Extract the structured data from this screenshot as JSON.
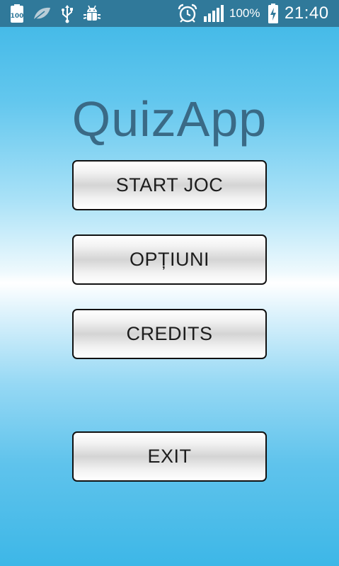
{
  "status_bar": {
    "background": "#30799a",
    "icons_left": [
      "battery-100-icon",
      "leaf-icon",
      "usb-icon",
      "android-debug-icon"
    ],
    "icons_right": [
      "alarm-clock-icon",
      "signal-bars-icon",
      "battery-charging-icon"
    ],
    "battery_label": "100",
    "battery_percent": "100%",
    "time": "21:40"
  },
  "app": {
    "title": "QuizApp",
    "title_color": "#3a6a86"
  },
  "menu": {
    "start_label": "START JOC",
    "options_label": "OPȚIUNI",
    "credits_label": "CREDITS",
    "exit_label": "EXIT"
  }
}
